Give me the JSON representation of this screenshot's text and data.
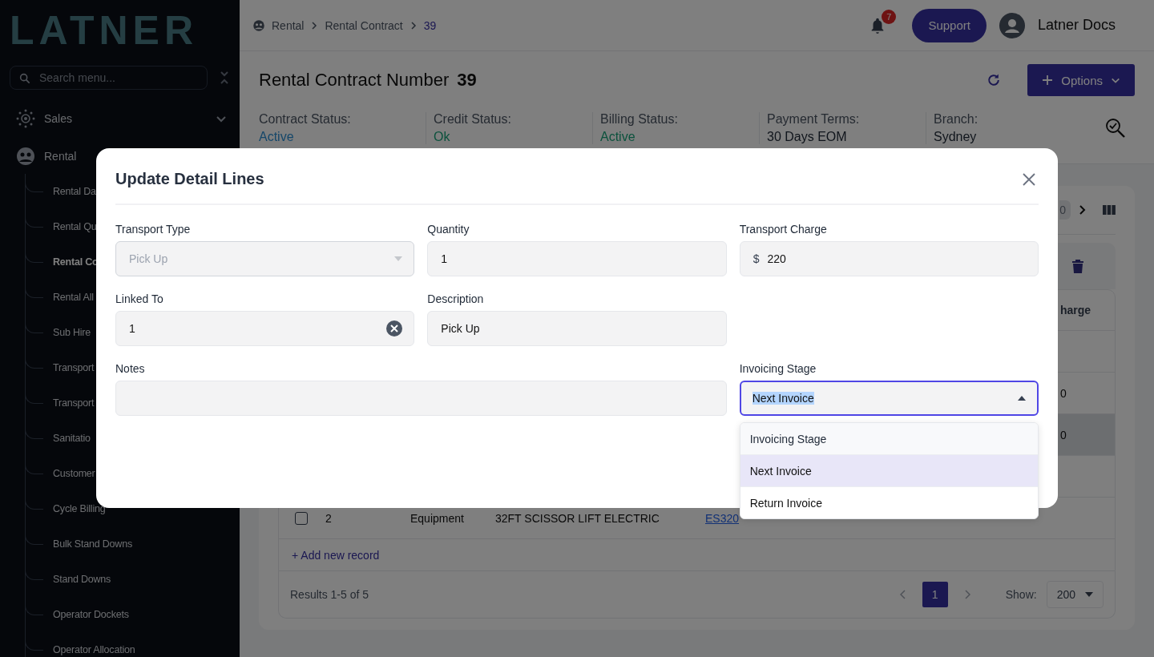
{
  "sidebar": {
    "logo": "LATNER",
    "search": {
      "placeholder": "Search menu..."
    },
    "groups": [
      {
        "label": "Sales",
        "expanded": false
      },
      {
        "label": "Rental",
        "expanded": true,
        "children": [
          {
            "label": "Rental Da",
            "selected": false
          },
          {
            "label": "Rental Qu",
            "selected": false
          },
          {
            "label": "Rental Co",
            "selected": true
          },
          {
            "label": "Rental All",
            "selected": false
          },
          {
            "label": "Sub Hire",
            "selected": false
          },
          {
            "label": "Transport",
            "selected": false
          },
          {
            "label": "Transport",
            "selected": false
          },
          {
            "label": "Sanitatio",
            "selected": false
          },
          {
            "label": "Customer",
            "selected": false
          },
          {
            "label": "Cycle Billing",
            "selected": false
          },
          {
            "label": "Bulk Stand Downs",
            "selected": false
          },
          {
            "label": "Stand Downs",
            "selected": false
          },
          {
            "label": "Operator Dockets",
            "selected": false
          },
          {
            "label": "Operator Allocation",
            "selected": false
          }
        ]
      }
    ]
  },
  "header": {
    "breadcrumb": [
      {
        "label": "Rental",
        "current": false
      },
      {
        "label": "Rental Contract",
        "current": false
      },
      {
        "label": "39",
        "current": true
      }
    ],
    "notification_count": "7",
    "support_button": "Support",
    "user": "Latner Docs"
  },
  "contract": {
    "title": "Rental Contract Number",
    "number": "39",
    "options_button": "Options",
    "statuses": [
      {
        "label": "Contract Status:",
        "value": "Active",
        "color": "#15476a"
      },
      {
        "label": "Credit Status:",
        "value": "Ok",
        "color": "#0c523d"
      },
      {
        "label": "Billing Status:",
        "value": "Active",
        "color": "#0c523d"
      },
      {
        "label": "Payment Terms:",
        "value": "30 Days EOM",
        "color": "#10151c"
      },
      {
        "label": "Branch:",
        "value": "Sydney",
        "color": "#10151c"
      }
    ]
  },
  "card": {
    "page_chip": "0",
    "last_column": {
      "label": "harge"
    },
    "rows": [
      {
        "selected": false
      },
      {
        "selected": false,
        "charge": "0"
      },
      {
        "selected": true,
        "charge": "0"
      },
      {
        "selected": false
      },
      {
        "selected": false,
        "checked": false,
        "index": "2",
        "type": "Equipment",
        "description": "32FT SCISSOR LIFT ELECTRIC",
        "code": "ES320"
      }
    ],
    "add_record": "+ Add new record",
    "results": "Results 1-5 of 5",
    "pages": [
      {
        "label": "1",
        "selected": true
      }
    ],
    "show_label": "Show:",
    "page_size": "200"
  },
  "modal": {
    "title": "Update Detail Lines",
    "fields": [
      {
        "kind": "select",
        "label": "Transport Type",
        "value": "Pick Up",
        "disabled": true
      },
      {
        "kind": "input",
        "label": "Quantity",
        "value": "1"
      },
      {
        "kind": "money",
        "label": "Transport Charge",
        "prefix": "$",
        "value": "220"
      },
      {
        "kind": "clearable",
        "label": "Linked To",
        "value": "1"
      },
      {
        "kind": "input",
        "label": "Description",
        "value": "Pick Up"
      },
      {
        "kind": "textarea",
        "label": "Notes"
      },
      {
        "kind": "open-select",
        "label": "Invoicing Stage",
        "value": "Next Invoice",
        "text_selected": true,
        "options": [
          {
            "label": "Invoicing Stage",
            "kind": "header",
            "selected": false
          },
          {
            "label": "Next Invoice",
            "kind": "option",
            "selected": true
          },
          {
            "label": "Return Invoice",
            "kind": "option",
            "selected": false
          }
        ]
      }
    ]
  }
}
